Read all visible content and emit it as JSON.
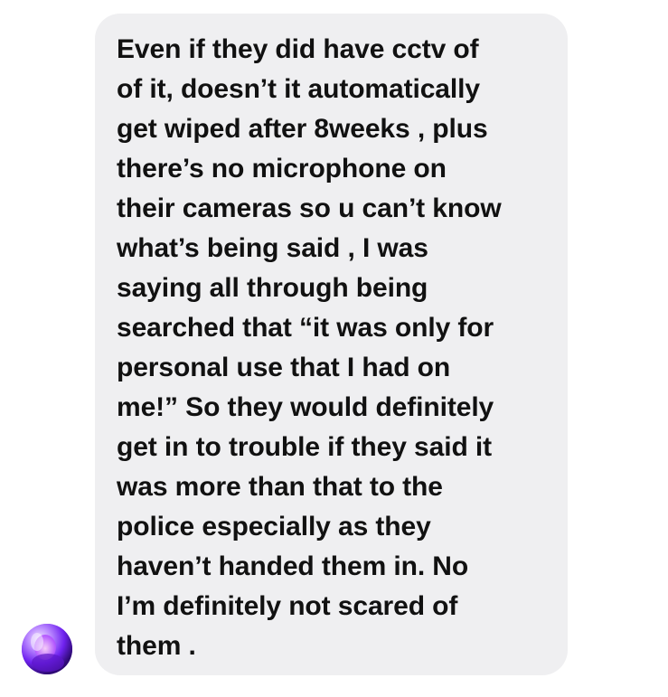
{
  "conversation": {
    "message": {
      "lines": [
        "Even if they did have cctv of",
        "of it, doesn’t it automatically",
        "get wiped after 8weeks , plus",
        "there’s no microphone on",
        "their cameras so u can’t know",
        "what’s being said , I was",
        "saying all through being",
        "searched that “it was only for",
        "personal use that I had on",
        "me!” So they would definitely",
        "get in to trouble if they said it",
        "was more than that to the",
        "police especially as they",
        "haven’t handed them in. No",
        "I’m definitely not scared of",
        "them ."
      ]
    }
  }
}
